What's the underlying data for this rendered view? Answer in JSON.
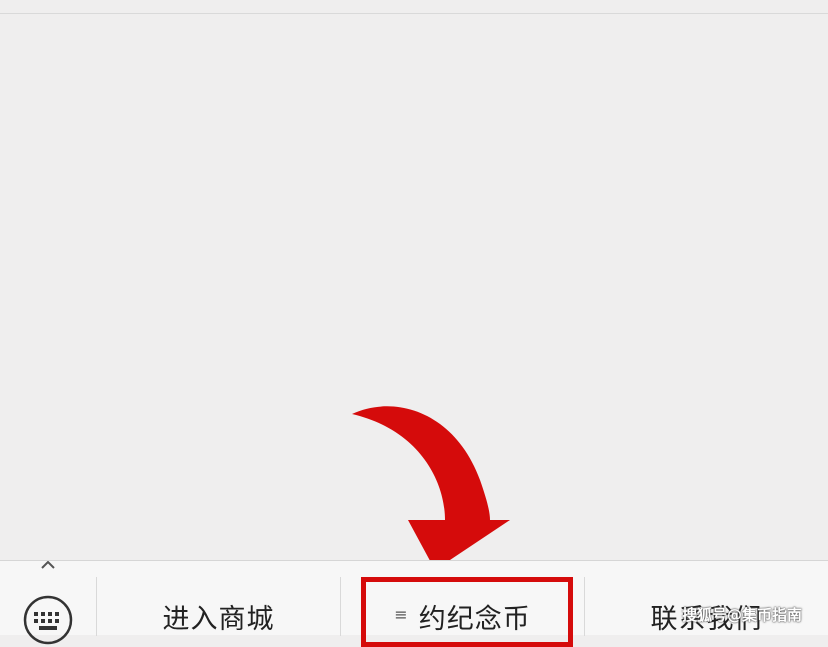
{
  "menu": {
    "items": [
      {
        "label": "进入商城"
      },
      {
        "label": "约纪念币",
        "sub_icon": "≡"
      },
      {
        "label": "联系我们"
      }
    ]
  },
  "annotations": {
    "highlight_color": "#d50b0b"
  },
  "watermark": {
    "text": "搜狐号@集币指南"
  },
  "icons": {
    "keyboard_toggle": "keyboard-icon",
    "caret": "caret-up-icon",
    "arrow": "red-curved-arrow"
  }
}
